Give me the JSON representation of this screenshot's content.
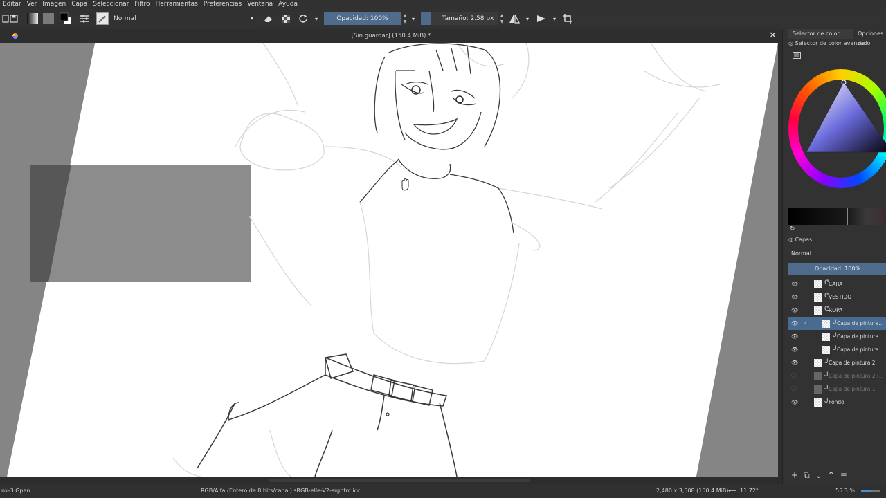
{
  "menu": [
    "Editar",
    "Ver",
    "Imagen",
    "Capa",
    "Seleccionar",
    "Filtro",
    "Herramientas",
    "Preferencias",
    "Ventana",
    "Ayuda"
  ],
  "toolbar": {
    "blend_mode": "Normal",
    "opacity_label": "Opacidad: 100%",
    "size_label": "Tamaño: 2.58 px"
  },
  "document": {
    "title": "[Sin guardar]  (150.4 MiB) *"
  },
  "docker": {
    "tabs": [
      "Selector de color ...",
      "Opciones de"
    ],
    "color_header": "Selector de color avanzado",
    "layers_header": "Capas",
    "layers_blend": "Normal",
    "layers_opacity": "Opacidad:  100%"
  },
  "layers": [
    {
      "name": "CARA",
      "visible": true,
      "group": true,
      "selected": false,
      "dim": false
    },
    {
      "name": "VESTIDO",
      "visible": true,
      "group": true,
      "selected": false,
      "dim": false
    },
    {
      "name": "ROPA",
      "visible": true,
      "group": true,
      "selected": false,
      "dim": false
    },
    {
      "name": "Capa de pintura...",
      "visible": true,
      "group": false,
      "selected": true,
      "dim": false
    },
    {
      "name": "Capa de pintura...",
      "visible": true,
      "group": false,
      "selected": false,
      "dim": false
    },
    {
      "name": "Capa de pintura...",
      "visible": true,
      "group": false,
      "selected": false,
      "dim": false
    },
    {
      "name": "Capa de pintura 2",
      "visible": true,
      "group": false,
      "selected": false,
      "dim": false
    },
    {
      "name": "Capa de pintura 2 (...",
      "visible": false,
      "group": false,
      "selected": false,
      "dim": true
    },
    {
      "name": "Capa de pintura 1",
      "visible": false,
      "group": false,
      "selected": false,
      "dim": true
    },
    {
      "name": "Fondo",
      "visible": true,
      "group": false,
      "selected": false,
      "dim": false
    }
  ],
  "status": {
    "brush": "nk-3 Gpen",
    "color_space": "RGB/Alfa (Entero de 8 bits/canal)  sRGB-elle-V2-srgbtrc.icc",
    "dimensions": "2,480 x 3,508 (150.4 MiB)",
    "rotation": "11.72°",
    "zoom": "55.3 %"
  },
  "colors": {
    "accent": "#4f6c8d",
    "panel": "#323232",
    "canvas_bg": "#8a8a8a"
  }
}
